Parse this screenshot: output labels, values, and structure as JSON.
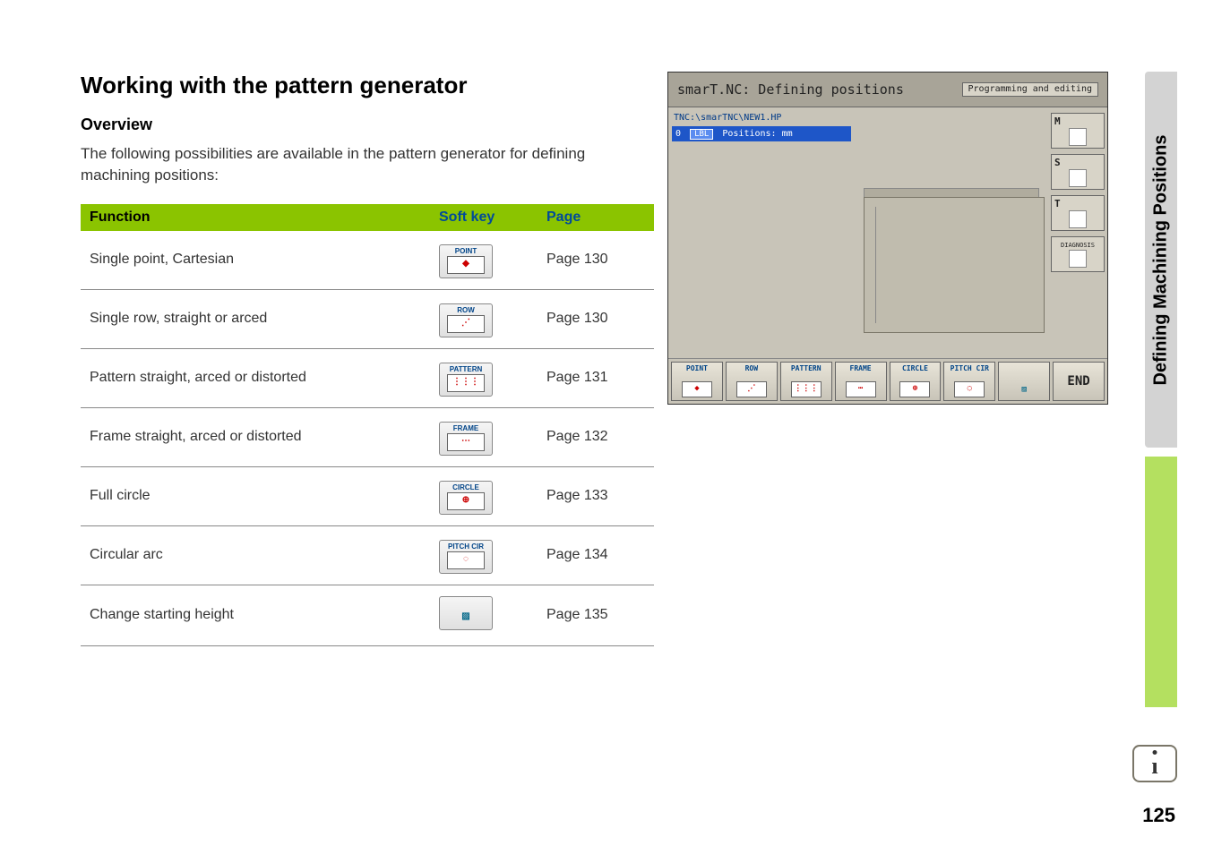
{
  "title": "Working with the pattern generator",
  "overview_heading": "Overview",
  "description": "The following possibilities are available in the pattern generator for defining machining positions:",
  "table": {
    "headers": {
      "function": "Function",
      "softkey": "Soft key",
      "page": "Page"
    },
    "rows": [
      {
        "function": "Single point, Cartesian",
        "softkey_label": "POINT",
        "softkey_glyph": "◆",
        "page": "Page 130"
      },
      {
        "function": "Single row, straight or arced",
        "softkey_label": "ROW",
        "softkey_glyph": "⋰",
        "page": "Page 130"
      },
      {
        "function": "Pattern straight, arced or distorted",
        "softkey_label": "PATTERN",
        "softkey_glyph": "⋮⋮⋮",
        "page": "Page 131"
      },
      {
        "function": "Frame straight, arced or distorted",
        "softkey_label": "FRAME",
        "softkey_glyph": "⋯",
        "page": "Page 132"
      },
      {
        "function": "Full circle",
        "softkey_label": "CIRCLE",
        "softkey_glyph": "⊕",
        "page": "Page 133"
      },
      {
        "function": "Circular arc",
        "softkey_label": "PITCH CIR",
        "softkey_glyph": "◌",
        "page": "Page 134"
      },
      {
        "function": "Change starting height",
        "softkey_label": "",
        "softkey_glyph": "▨",
        "page": "Page 135"
      }
    ]
  },
  "screenshot": {
    "title": "smarT.NC: Defining positions",
    "mode_label": "Programming and editing",
    "path": "TNC:\\smarTNC\\NEW1.HP",
    "active_row_prefix": "0",
    "active_row_badge": "LBL",
    "active_row_text": "Positions: mm",
    "side_buttons": [
      {
        "letter": "M"
      },
      {
        "letter": "S"
      },
      {
        "letter": "T"
      },
      {
        "label": "DIAGNOSIS"
      }
    ],
    "softkeys": [
      {
        "label": "POINT"
      },
      {
        "label": "ROW"
      },
      {
        "label": "PATTERN"
      },
      {
        "label": "FRAME"
      },
      {
        "label": "CIRCLE"
      },
      {
        "label": "PITCH CIR"
      },
      {
        "label": ""
      },
      {
        "label": "END"
      }
    ]
  },
  "side_tab": "Defining Machining Positions",
  "page_number": "125"
}
